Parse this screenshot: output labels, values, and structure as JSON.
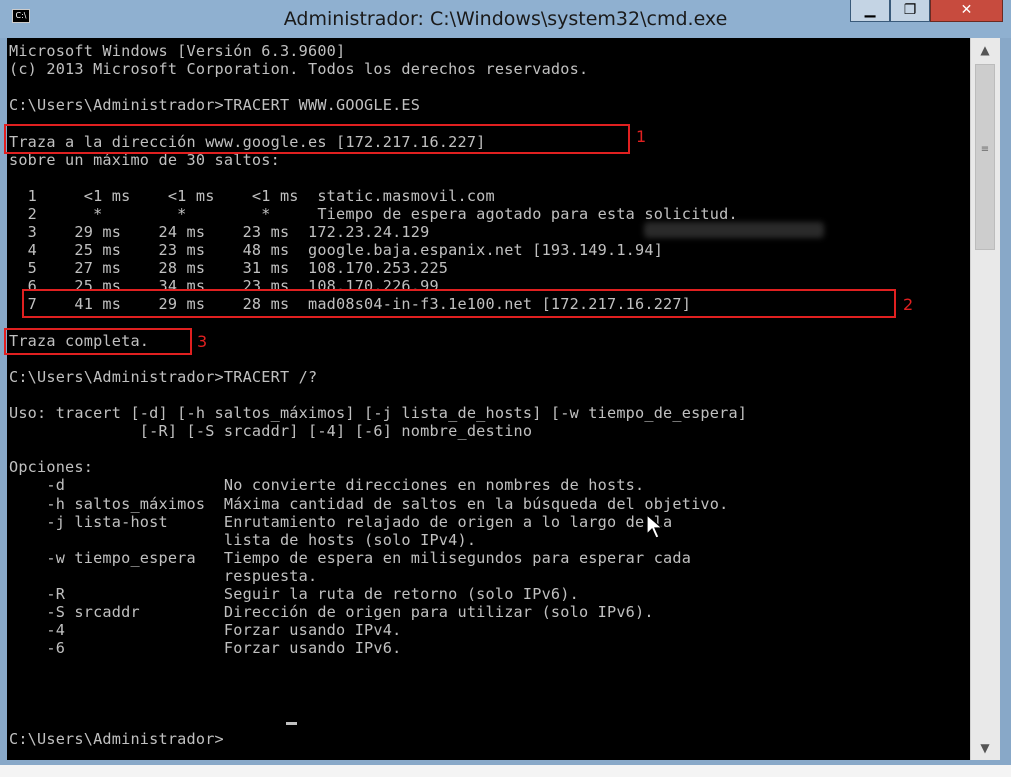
{
  "window": {
    "title": "Administrador: C:\\Windows\\system32\\cmd.exe",
    "icon_label": "C:\\",
    "buttons": {
      "minimize": "minimize-icon",
      "maximize": "restore-icon",
      "close": "close-icon"
    }
  },
  "console": {
    "lines": [
      "Microsoft Windows [Versión 6.3.9600]",
      "(c) 2013 Microsoft Corporation. Todos los derechos reservados.",
      "",
      "C:\\Users\\Administrador>TRACERT WWW.GOOGLE.ES",
      "",
      "Traza a la dirección www.google.es [172.217.16.227]",
      "sobre un máximo de 30 saltos:",
      "",
      "  1     <1 ms    <1 ms    <1 ms  static.masmovil.com",
      "  2      *        *        *     Tiempo de espera agotado para esta solicitud.",
      "  3    29 ms    24 ms    23 ms  172.23.24.129",
      "  4    25 ms    23 ms    48 ms  google.baja.espanix.net [193.149.1.94]",
      "  5    27 ms    28 ms    31 ms  108.170.253.225",
      "  6    25 ms    34 ms    23 ms  108.170.226.99",
      "  7    41 ms    29 ms    28 ms  mad08s04-in-f3.1e100.net [172.217.16.227]",
      "",
      "Traza completa.",
      "",
      "C:\\Users\\Administrador>TRACERT /?",
      "",
      "Uso: tracert [-d] [-h saltos_máximos] [-j lista_de_hosts] [-w tiempo_de_espera]",
      "              [-R] [-S srcaddr] [-4] [-6] nombre_destino",
      "",
      "Opciones:",
      "    -d                 No convierte direcciones en nombres de hosts.",
      "    -h saltos_máximos  Máxima cantidad de saltos en la búsqueda del objetivo.",
      "    -j lista-host      Enrutamiento relajado de origen a lo largo de la",
      "                       lista de hosts (solo IPv4).",
      "    -w tiempo_espera   Tiempo de espera en milisegundos para esperar cada",
      "                       respuesta.",
      "    -R                 Seguir la ruta de retorno (solo IPv6).",
      "    -S srcaddr         Dirección de origen para utilizar (solo IPv6).",
      "    -4                 Forzar usando IPv4.",
      "    -6                 Forzar usando IPv6.",
      "",
      "",
      "",
      "",
      "C:\\Users\\Administrador>"
    ]
  },
  "annotations": [
    {
      "label": "1"
    },
    {
      "label": "2"
    },
    {
      "label": "3"
    }
  ],
  "colors": {
    "console_bg": "#000000",
    "console_fg": "#c0c0c0",
    "highlight": "#e02020",
    "close_button": "#c74b3e"
  }
}
